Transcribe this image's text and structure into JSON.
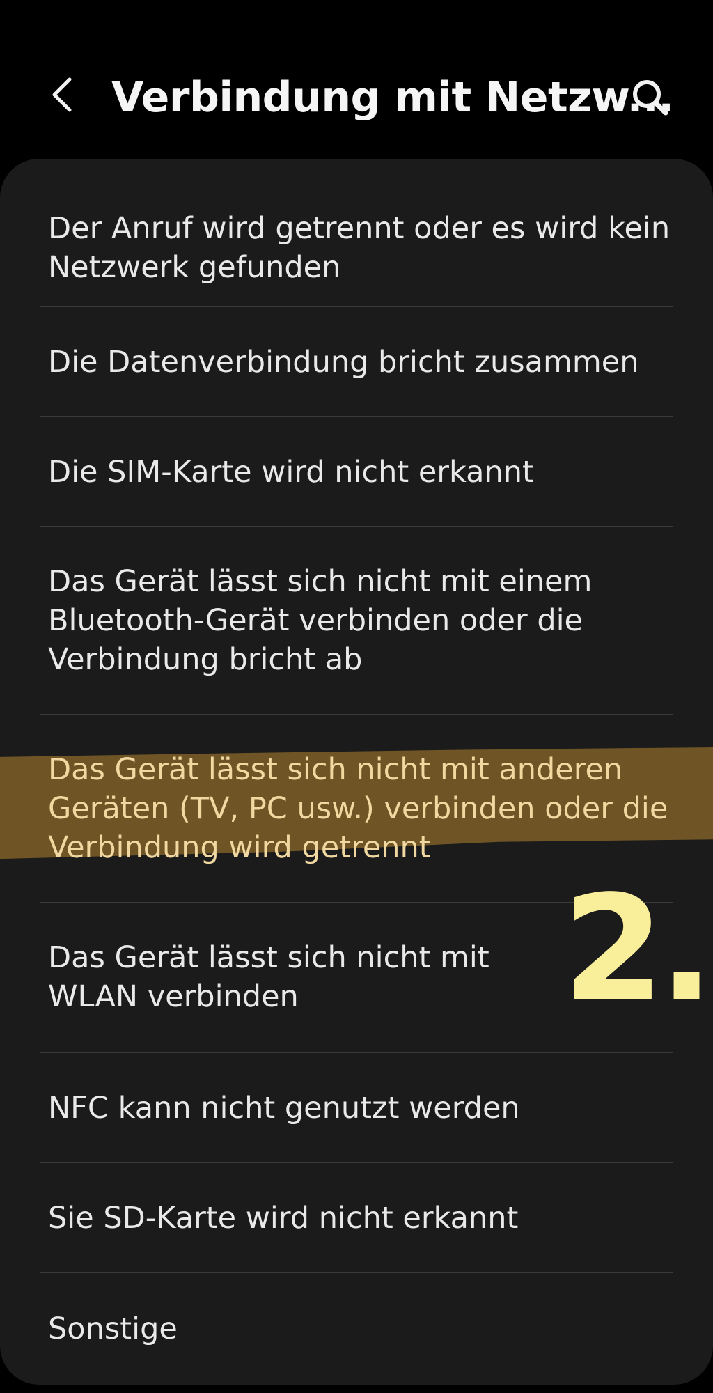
{
  "header": {
    "title": "Verbindung mit Netzw...",
    "back_icon": "chevron-left-icon",
    "search_icon": "search-icon"
  },
  "items": [
    {
      "label": "Der Anruf wird getrennt oder es wird kein Netzwerk gefunden"
    },
    {
      "label": "Die Datenverbindung bricht zusammen"
    },
    {
      "label": "Die SIM-Karte wird nicht erkannt"
    },
    {
      "label": "Das Gerät lässt sich nicht mit einem Bluetooth-Gerät verbinden oder die Verbindung bricht ab"
    },
    {
      "label": "Das Gerät lässt sich nicht mit anderen Geräten (TV, PC usw.) verbinden oder die Verbindung wird getrennt"
    },
    {
      "label": "Das Gerät lässt sich nicht mit WLAN verbinden"
    },
    {
      "label": "NFC kann nicht genutzt werden"
    },
    {
      "label": "Sie SD-Karte wird nicht erkannt"
    },
    {
      "label": "Sonstige"
    }
  ],
  "annotation": {
    "step_number": "2.",
    "highlight_color": "#6f5526",
    "number_color": "#f9ef9b"
  },
  "colors": {
    "background": "#000000",
    "card": "#1b1b1b",
    "text": "#e9e9e9",
    "divider": "#3b3b3b"
  }
}
